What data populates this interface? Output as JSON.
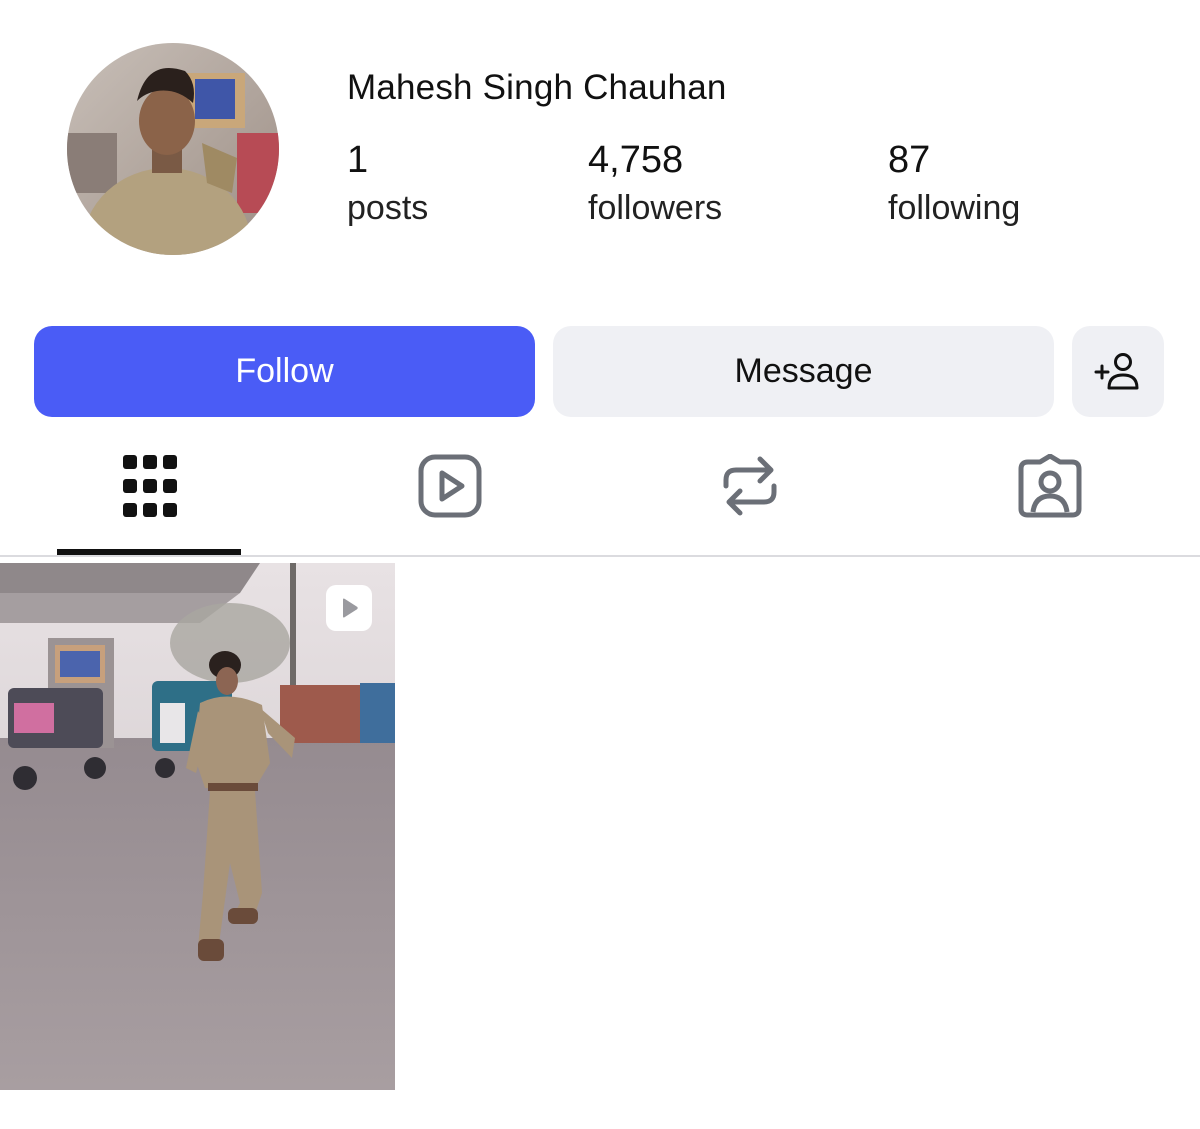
{
  "profile": {
    "name": "Mahesh Singh Chauhan",
    "avatar_icon": "profile-photo"
  },
  "stats": {
    "posts_count": "1",
    "posts_label": "posts",
    "followers_count": "4,758",
    "followers_label": "followers",
    "following_count": "87",
    "following_label": "following"
  },
  "actions": {
    "follow_label": "Follow",
    "message_label": "Message",
    "add_user_icon": "add-user-icon"
  },
  "tabs": [
    {
      "icon": "grid-icon",
      "active": true
    },
    {
      "icon": "reels-icon",
      "active": false
    },
    {
      "icon": "reposts-icon",
      "active": false
    },
    {
      "icon": "tagged-icon",
      "active": false
    }
  ],
  "posts": [
    {
      "type": "reel",
      "badge_icon": "play-icon"
    }
  ],
  "colors": {
    "follow_button": "#4a5cf6",
    "secondary_button": "#eff0f4",
    "tab_icon": "#6b6f77",
    "active_tab": "#111111"
  }
}
